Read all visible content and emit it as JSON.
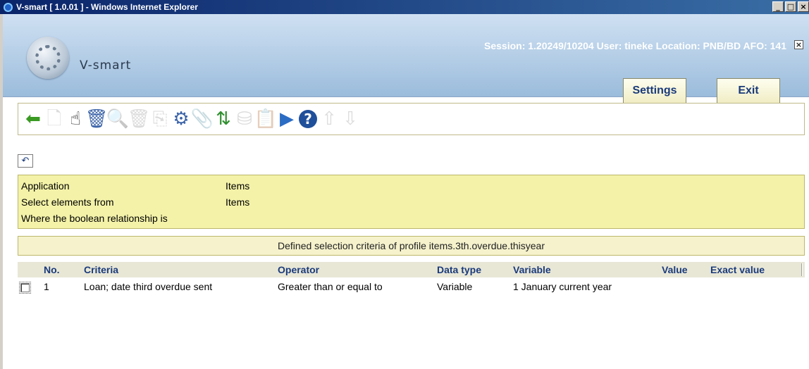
{
  "window": {
    "title": "V-smart [ 1.0.01 ] - Windows Internet Explorer",
    "controls": [
      "_",
      "□",
      "×"
    ]
  },
  "app": {
    "brand": "V-smart",
    "session_info": "Session: 1.20249/10204   User: tineke   Location: PNB/BD   AFO: 141",
    "close_label": "×",
    "settings_label": "Settings",
    "exit_label": "Exit"
  },
  "toolbar": {
    "icons": [
      {
        "name": "back-icon",
        "glyph": "⬅",
        "color": "#3a9a22",
        "enabled": true
      },
      {
        "name": "new-document-icon",
        "glyph": "🗋",
        "color": "#9a9a9a",
        "enabled": false
      },
      {
        "name": "select-hand-icon",
        "glyph": "☝",
        "color": "#222222",
        "enabled": true
      },
      {
        "name": "delete-bin-icon",
        "glyph": "🗑",
        "color": "#3b63a8",
        "enabled": true
      },
      {
        "name": "search-icon",
        "glyph": "🔍",
        "color": "#9a9a9a",
        "enabled": false
      },
      {
        "name": "delete-disabled-icon",
        "glyph": "🗑",
        "color": "#9a9a9a",
        "enabled": false
      },
      {
        "name": "copy-icon",
        "glyph": "⎘",
        "color": "#9a9a9a",
        "enabled": false
      },
      {
        "name": "edit-settings-icon",
        "glyph": "⚙",
        "color": "#3b63a8",
        "enabled": true
      },
      {
        "name": "attach-icon",
        "glyph": "📎",
        "color": "#9a9a9a",
        "enabled": false
      },
      {
        "name": "swap-arrows-icon",
        "glyph": "⇅",
        "color": "#2f8f2f",
        "enabled": true
      },
      {
        "name": "database-icon",
        "glyph": "⛁",
        "color": "#9a9a9a",
        "enabled": false
      },
      {
        "name": "clipboard-icon",
        "glyph": "📋",
        "color": "#9a9a9a",
        "enabled": false
      },
      {
        "name": "run-play-icon",
        "glyph": "▶",
        "color": "#2b6cc4",
        "enabled": true
      },
      {
        "name": "help-icon",
        "glyph": "?",
        "color": "#1f4f9a",
        "enabled": true
      },
      {
        "name": "move-up-icon",
        "glyph": "⇧",
        "color": "#9a9a9a",
        "enabled": false
      },
      {
        "name": "move-down-icon",
        "glyph": "⇩",
        "color": "#9a9a9a",
        "enabled": false
      }
    ]
  },
  "undo_glyph": "↶",
  "info": {
    "rows": [
      {
        "label": "Application",
        "value": "Items"
      },
      {
        "label": "Select elements from",
        "value": "Items"
      },
      {
        "label": "Where the boolean relationship is",
        "value": ""
      }
    ]
  },
  "caption": "Defined selection criteria of profile items.3th.overdue.thisyear",
  "table": {
    "headers": {
      "no": "No.",
      "criteria": "Criteria",
      "operator": "Operator",
      "data_type": "Data type",
      "variable": "Variable",
      "value": "Value",
      "exact_value": "Exact value"
    },
    "rows": [
      {
        "no": "1",
        "criteria": "Loan; date third overdue sent",
        "operator": "Greater than or equal to",
        "data_type": "Variable",
        "variable": "1 January current year",
        "value": "",
        "exact_value": ""
      }
    ]
  }
}
